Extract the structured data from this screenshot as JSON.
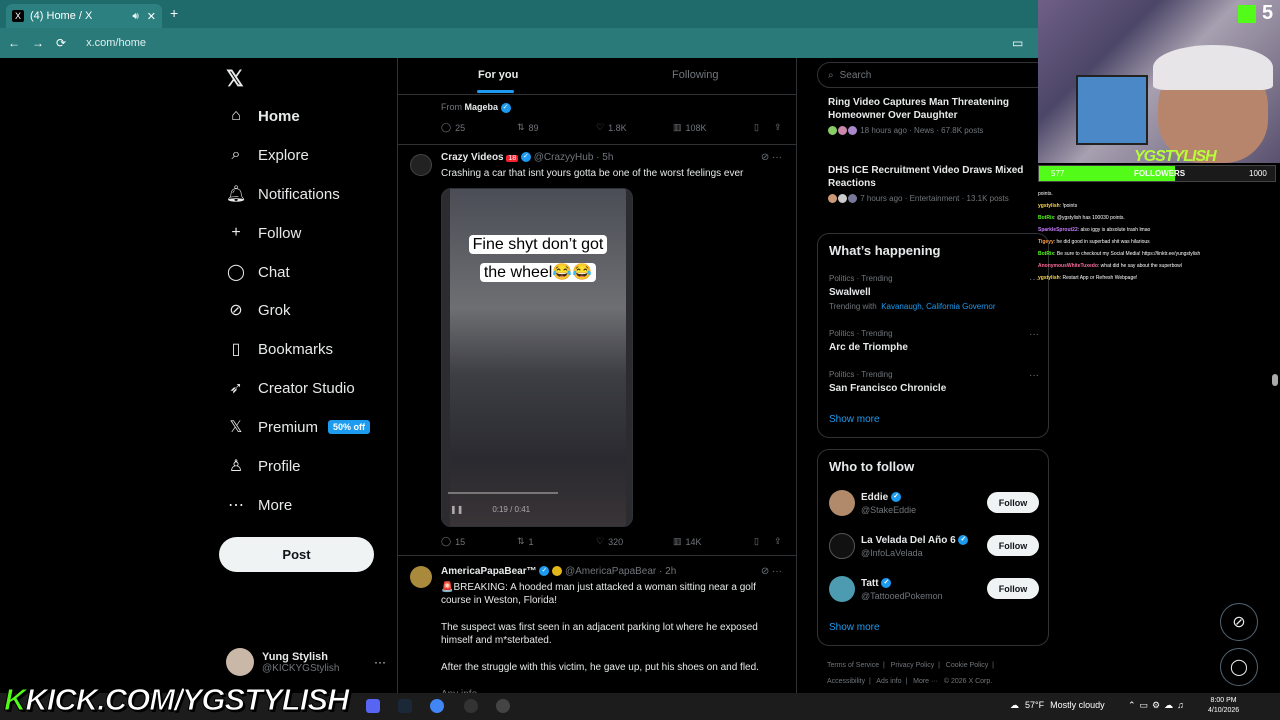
{
  "browser": {
    "tab_title": "(4) Home / X",
    "tab_favicon": "X",
    "tab_close": "✕",
    "new_tab": "+",
    "url": "x.com/home",
    "back_icon": "←",
    "forward_icon": "→",
    "reload_icon": "⟳"
  },
  "sidebar": {
    "logo": "𝕏",
    "items": [
      {
        "label": "Home",
        "icon": "⌂"
      },
      {
        "label": "Explore",
        "icon": "⌕"
      },
      {
        "label": "Notifications",
        "icon": "🔔︎",
        "badge": "4"
      },
      {
        "label": "Follow",
        "icon": "+"
      },
      {
        "label": "Chat",
        "icon": "◯"
      },
      {
        "label": "Grok",
        "icon": "⊘"
      },
      {
        "label": "Bookmarks",
        "icon": "▯"
      },
      {
        "label": "Creator Studio",
        "icon": "➶"
      },
      {
        "label": "Premium",
        "icon": "𝕏",
        "badge": "50% off"
      },
      {
        "label": "Profile",
        "icon": "♙"
      },
      {
        "label": "More",
        "icon": "⋯"
      }
    ],
    "post_label": "Post",
    "user_name": "Yung Stylish",
    "user_handle": "@KICKYGStylish",
    "user_menu": "···"
  },
  "feed": {
    "tabs": [
      "For you",
      "Following"
    ],
    "prev_tweet": {
      "from_label": "From",
      "from_name": "Mageba",
      "replies": "25",
      "retweets": "89",
      "likes": "1.8K",
      "views": "108K"
    },
    "tweet1": {
      "name": "Crazy Videos",
      "age_tag": "18",
      "handle": "@CrazyyHub",
      "time": "· 5h",
      "text": "Crashing a car that isnt yours gotta be one of the worst feelings ever",
      "video_caption": "Fine shyt don’t got the wheel😂😂",
      "video_time": "0:19 / 0:41",
      "replies": "15",
      "retweets": "1",
      "likes": "320",
      "views": "14K"
    },
    "tweet2": {
      "name": "AmericaPapaBear™",
      "handle": "@AmericaPapaBear",
      "time": "· 2h",
      "para1": "🚨BREAKING: A hooded man just attacked a woman sitting near a golf course in Weston, Florida!",
      "para2": "The suspect was first seen in an adjacent parking lot where he exposed himself and m*sterbated.",
      "para3": "After the struggle with this victim, he gave up, put his shoes on and fled.",
      "para4": "Any info..."
    }
  },
  "right": {
    "search_placeholder": "Search",
    "news": [
      {
        "title": "Ring Video Captures Man Threatening Homeowner Over Daughter",
        "meta": "18 hours ago · News · 67.8K posts"
      },
      {
        "title": "DHS ICE Recruitment Video Draws Mixed Reactions",
        "meta": "7 hours ago · Entertainment · 13.1K posts"
      }
    ],
    "happening_title": "What’s happening",
    "trends": [
      {
        "category": "Politics · Trending",
        "name": "Swalwell",
        "with_label": "Trending with",
        "with_links": "Kavanaugh, California Governor"
      },
      {
        "category": "Politics · Trending",
        "name": "Arc de Triomphe"
      },
      {
        "category": "Politics · Trending",
        "name": "San Francisco Chronicle"
      }
    ],
    "show_more": "Show more",
    "follow_title": "Who to follow",
    "follow": [
      {
        "name": "Eddie",
        "handle": "@StakeEddie",
        "button": "Follow"
      },
      {
        "name": "La Velada Del Año 6",
        "handle": "@InfoLaVelada",
        "button": "Follow"
      },
      {
        "name": "Tatt",
        "handle": "@TattooedPokemon",
        "button": "Follow"
      }
    ],
    "footer": [
      "Terms of Service",
      "Privacy Policy",
      "Cookie Policy",
      "Accessibility",
      "Ads info",
      "More ···",
      "© 2026 X Corp."
    ]
  },
  "stream": {
    "kick_count": "5",
    "cam_brand": "YGSTYLISH",
    "follow_left": "577",
    "follow_label": "FOLLOWERS",
    "follow_right": "1000",
    "follow_progress": 0.577,
    "chat": [
      {
        "user": "",
        "text": "points."
      },
      {
        "user": "ygstylish",
        "text": ": !points"
      },
      {
        "user": "BotRix",
        "text": ": @ygstylish has 100030 points."
      },
      {
        "user": "SparkleSprout22",
        "text": ": also iggy is absolute trash lmao"
      },
      {
        "user": "Tigeyy",
        "text": ": he did good in superbad shit was hilarious"
      },
      {
        "user": "BotRix",
        "text": ": Be sure to checkout my Social Media! https://linktr.ee/yungstylish"
      },
      {
        "user": "AnonymousWhiteTuxedo",
        "text": ": what did he say about the superbowl"
      },
      {
        "user": "ygstylish",
        "text": ": Restart App or Refresh Webpage!"
      }
    ],
    "banner_k": "K",
    "banner_text": "KICK.COM/YGSTYLISH"
  },
  "taskbar": {
    "temp": "57°F",
    "weather": "Mostly cloudy",
    "time": "8:00 PM",
    "date": "4/10/2026"
  },
  "colors": {
    "accent": "#1d9bf0",
    "kick_green": "#53fc18",
    "chrome": "#2a7a7a"
  }
}
